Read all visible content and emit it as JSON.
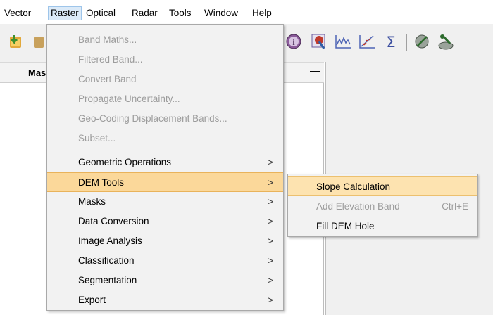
{
  "menubar": {
    "items": [
      {
        "label": "Vector"
      },
      {
        "label": "Raster"
      },
      {
        "label": "Optical"
      },
      {
        "label": "Radar"
      },
      {
        "label": "Tools"
      },
      {
        "label": "Window"
      },
      {
        "label": "Help"
      }
    ]
  },
  "toolbar": {
    "icons": [
      "open-product-icon",
      "product-icon",
      "information-icon",
      "spectrum-view-icon",
      "profile-plot-icon",
      "scatter-plot-icon",
      "statistics-sigma-icon",
      "pin-tool-icon",
      "gcp-tool-icon"
    ],
    "sigma_glyph": "Σ"
  },
  "left_panel": {
    "header_label": "Mas",
    "minimize_glyph": "—"
  },
  "raster_menu": {
    "items": [
      {
        "label": "Band Maths...",
        "enabled": false
      },
      {
        "label": "Filtered Band...",
        "enabled": false
      },
      {
        "label": "Convert Band",
        "enabled": false
      },
      {
        "label": "Propagate Uncertainty...",
        "enabled": false
      },
      {
        "label": "Geo-Coding Displacement Bands...",
        "enabled": false
      },
      {
        "label": "Subset...",
        "enabled": false
      },
      {
        "label": "Geometric Operations",
        "enabled": true,
        "submenu": true
      },
      {
        "label": "DEM Tools",
        "enabled": true,
        "submenu": true,
        "highlighted": true
      },
      {
        "label": "Masks",
        "enabled": true,
        "submenu": true
      },
      {
        "label": "Data Conversion",
        "enabled": true,
        "submenu": true
      },
      {
        "label": "Image Analysis",
        "enabled": true,
        "submenu": true
      },
      {
        "label": "Classification",
        "enabled": true,
        "submenu": true
      },
      {
        "label": "Segmentation",
        "enabled": true,
        "submenu": true
      },
      {
        "label": "Export",
        "enabled": true,
        "submenu": true
      }
    ],
    "arrow_glyph": ">"
  },
  "dem_submenu": {
    "items": [
      {
        "label": "Slope Calculation",
        "enabled": true,
        "highlighted": true
      },
      {
        "label": "Add Elevation Band",
        "enabled": false,
        "accelerator": "Ctrl+E"
      },
      {
        "label": "Fill DEM Hole",
        "enabled": true
      }
    ]
  },
  "colors": {
    "menu_highlight": "#fbd89a",
    "menu_background": "#f2f2f2",
    "disabled_text": "#9c9c9c"
  }
}
